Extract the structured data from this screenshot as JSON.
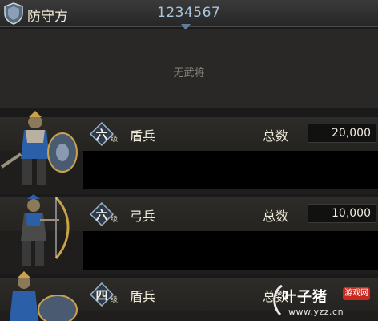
{
  "header": {
    "side_label": "防守方",
    "player_id": "1234567"
  },
  "general_slot": {
    "empty_text": "无武将"
  },
  "units": [
    {
      "tier": "六",
      "tier_suffix": "级",
      "name": "盾兵",
      "total_label": "总数",
      "total": "20,000",
      "portrait": "shield-soldier"
    },
    {
      "tier": "六",
      "tier_suffix": "级",
      "name": "弓兵",
      "total_label": "总数",
      "total": "10,000",
      "portrait": "archer-soldier"
    },
    {
      "tier": "四",
      "tier_suffix": "级",
      "name": "盾兵",
      "total_label": "总数",
      "total": "",
      "portrait": "shield-soldier"
    }
  ],
  "watermark": {
    "brand": "叶子猪",
    "tag": "游戏网",
    "url": "www.yzz.cn"
  },
  "colors": {
    "accent_blue": "#a9c4dc",
    "armor_blue": "#2b5fa8",
    "gold": "#c9a24a"
  }
}
